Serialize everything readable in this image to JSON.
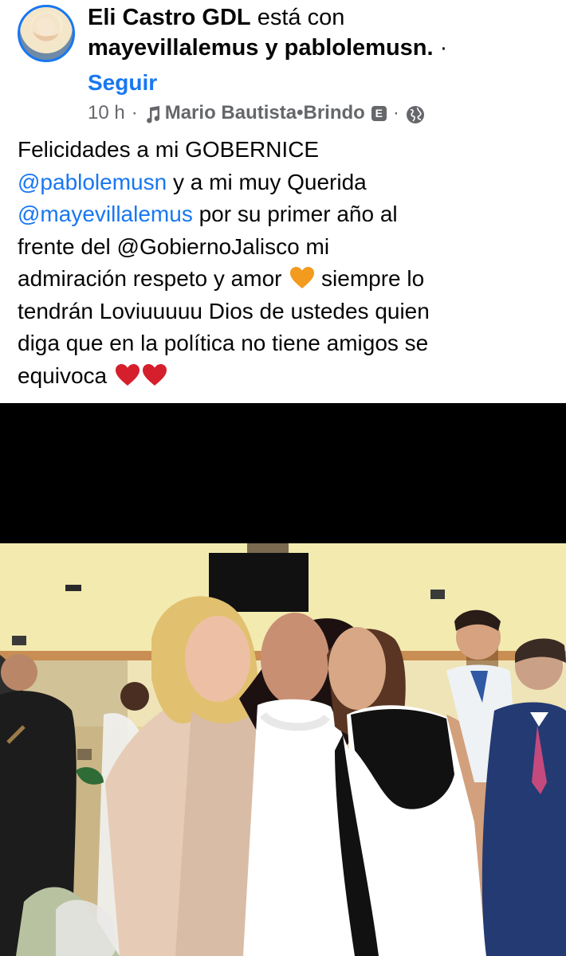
{
  "header": {
    "author": "Eli Castro GDL",
    "with_text": "está con",
    "tagged": "mayevillalemus y pablolemusn.",
    "dot": "·",
    "follow_label": "Seguir",
    "time": "10 h",
    "music_artist": "Mario Bautista",
    "music_song": "Brindo",
    "explicit_badge": "E"
  },
  "post": {
    "lines": [
      [
        "Felicidades a mi GOBERNICE"
      ],
      [
        "@pablolemusn",
        " y a mi muy Querida"
      ],
      [
        "@mayevillalemus",
        " por su primer año al"
      ],
      [
        "frente del @GobiernoJalisco mi"
      ],
      [
        "admiración respeto y amor ",
        " siempre lo"
      ],
      [
        "tendrán Loviuuuuu Dios de ustedes quien"
      ],
      [
        "diga que en la política no tiene amigos se"
      ],
      [
        "equivoca "
      ]
    ]
  },
  "colors": {
    "link": "#1877f2",
    "meta": "#65676b",
    "orange_heart": "#f29b1e",
    "red_heart": "#d61f2c"
  },
  "icons": [
    "avatar",
    "music-note-icon",
    "explicit-badge",
    "globe-icon",
    "orange-heart-icon",
    "red-heart-icon"
  ]
}
